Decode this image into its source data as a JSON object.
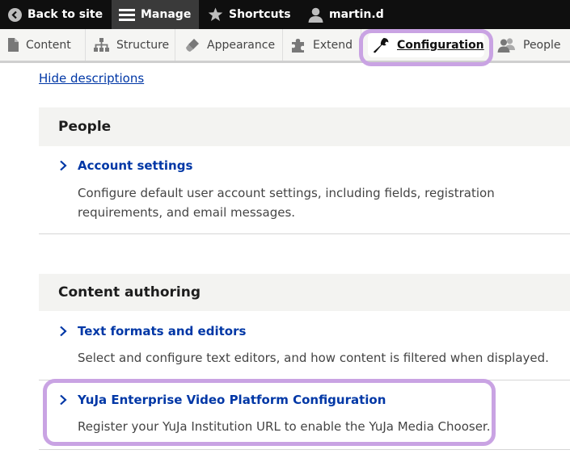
{
  "toolbar": {
    "back_label": "Back to site",
    "manage_label": "Manage",
    "shortcuts_label": "Shortcuts",
    "user_label": "martin.d"
  },
  "admin_menu": {
    "items": [
      {
        "label": "Content",
        "icon": "document-icon"
      },
      {
        "label": "Structure",
        "icon": "sitemap-icon"
      },
      {
        "label": "Appearance",
        "icon": "paintbrush-icon"
      },
      {
        "label": "Extend",
        "icon": "puzzle-icon"
      },
      {
        "label": "Configuration",
        "icon": "wrench-icon",
        "active": true
      },
      {
        "label": "People",
        "icon": "people-icon"
      }
    ]
  },
  "hide_descriptions": "Hide descriptions",
  "sections": [
    {
      "title": "People",
      "items": [
        {
          "title": "Account settings",
          "description": "Configure default user account settings, including fields, registration requirements, and email messages."
        }
      ]
    },
    {
      "title": "Content authoring",
      "items": [
        {
          "title": "Text formats and editors",
          "description": "Select and configure text editors, and how content is filtered when displayed."
        },
        {
          "title": "YuJa Enterprise Video Platform Configuration",
          "description": "Register your YuJa Institution URL to enable the YuJa Media Chooser."
        }
      ]
    }
  ],
  "colors": {
    "toolbar_bg": "#0f0f0f",
    "link": "#0037a6",
    "highlight": "#c9a3e3",
    "panel_bg": "#f3f3f1"
  }
}
